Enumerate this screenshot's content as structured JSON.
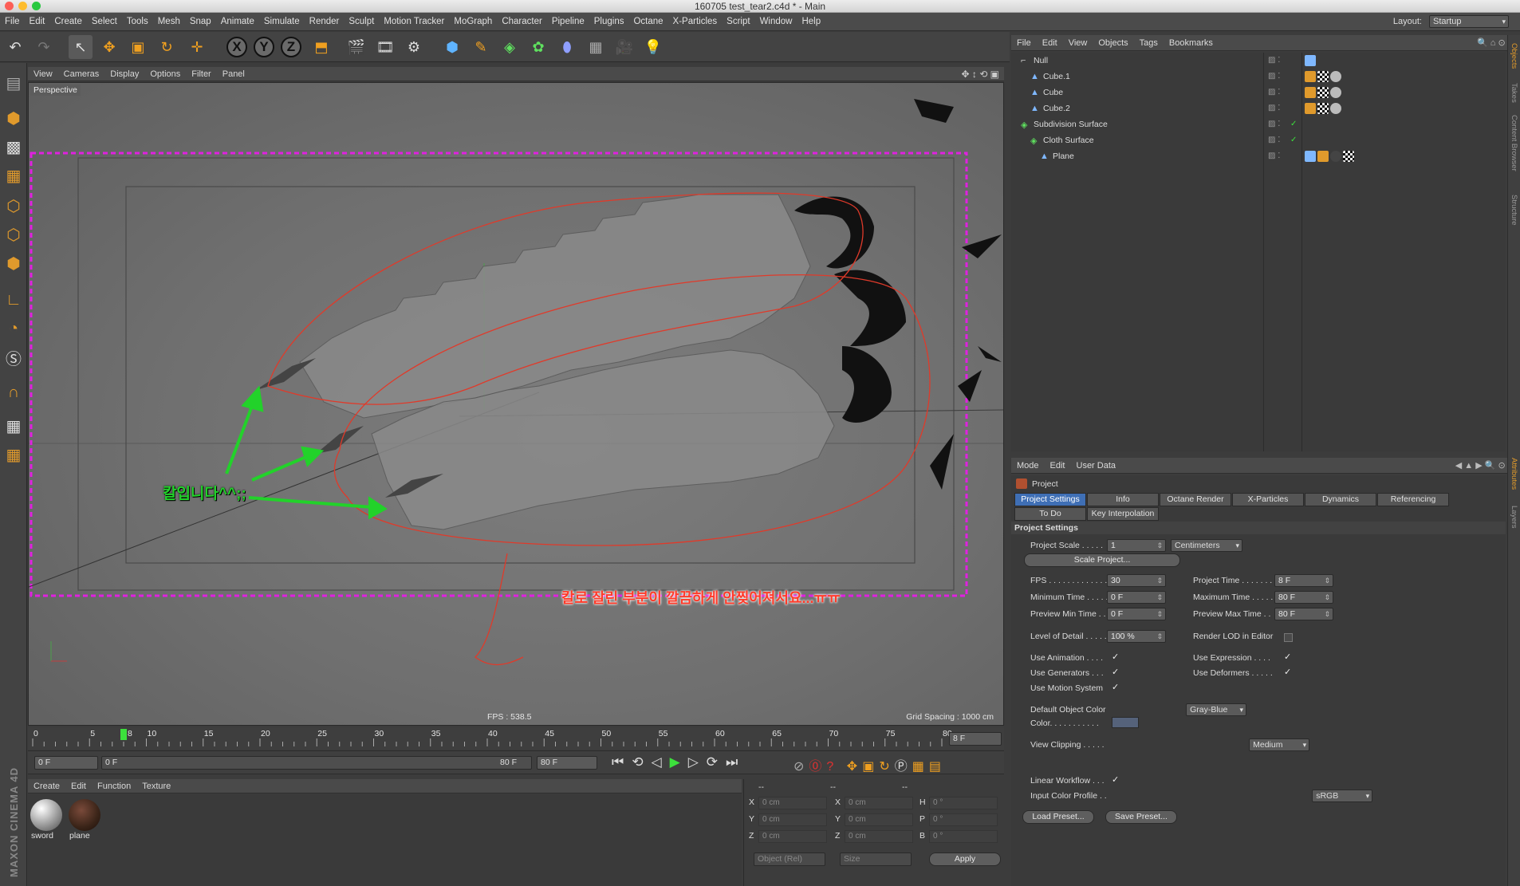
{
  "window": {
    "title": "160705 test_tear2.c4d * - Main"
  },
  "menubar": {
    "items": [
      "File",
      "Edit",
      "Create",
      "Select",
      "Tools",
      "Mesh",
      "Snap",
      "Animate",
      "Simulate",
      "Render",
      "Sculpt",
      "Motion Tracker",
      "MoGraph",
      "Character",
      "Pipeline",
      "Plugins",
      "Octane",
      "X-Particles",
      "Script",
      "Window",
      "Help"
    ],
    "layout_label": "Layout:",
    "layout_value": "Startup"
  },
  "toolbar": {
    "axis_x": "X",
    "axis_y": "Y",
    "axis_z": "Z"
  },
  "viewport": {
    "menu": [
      "View",
      "Cameras",
      "Display",
      "Options",
      "Filter",
      "Panel"
    ],
    "camera_label": "Perspective",
    "fps": "FPS : 538.5",
    "grid_spacing": "Grid Spacing : 1000 cm",
    "annotation_knife": "칼입니다^^;;",
    "annotation_problem": "칼로 잘린 부분이 깔끔하게 안찢어져서요...ㅠㅠ",
    "colors": {
      "annotation_green": "#22d22a",
      "annotation_red": "#e03a2a",
      "safe_frame": "#e020e0"
    }
  },
  "timeline": {
    "ticks": [
      "0",
      "5",
      "10",
      "15",
      "20",
      "25",
      "30",
      "35",
      "40",
      "45",
      "50",
      "55",
      "60",
      "65",
      "70",
      "75",
      "80"
    ],
    "current_frame_marker": "8",
    "end_field": "8 F"
  },
  "anim_bar": {
    "start_field": "0 F",
    "range_start": "0 F",
    "range_end": "80 F",
    "end_field": "80 F"
  },
  "materials": {
    "menu": [
      "Create",
      "Edit",
      "Function",
      "Texture"
    ],
    "items": [
      {
        "name": "sword"
      },
      {
        "name": "plane"
      }
    ]
  },
  "coordinates": {
    "header_left": "--",
    "header_mid": "--",
    "header_right": "--",
    "rows": [
      {
        "pos_label": "X",
        "pos": "0 cm",
        "size_label": "X",
        "size": "0 cm",
        "rot_label": "H",
        "rot": "0 °"
      },
      {
        "pos_label": "Y",
        "pos": "0 cm",
        "size_label": "Y",
        "size": "0 cm",
        "rot_label": "P",
        "rot": "0 °"
      },
      {
        "pos_label": "Z",
        "pos": "0 cm",
        "size_label": "Z",
        "size": "0 cm",
        "rot_label": "B",
        "rot": "0 °"
      }
    ],
    "mode_dropdown": "Object (Rel)",
    "size_dropdown": "Size",
    "apply": "Apply"
  },
  "objects": {
    "menu": [
      "File",
      "Edit",
      "View",
      "Objects",
      "Tags",
      "Bookmarks"
    ],
    "tree": [
      {
        "name": "Null",
        "depth": 0
      },
      {
        "name": "Cube.1",
        "depth": 1
      },
      {
        "name": "Cube",
        "depth": 1
      },
      {
        "name": "Cube.2",
        "depth": 1
      },
      {
        "name": "Subdivision Surface",
        "depth": 0
      },
      {
        "name": "Cloth Surface",
        "depth": 1
      },
      {
        "name": "Plane",
        "depth": 2
      }
    ]
  },
  "attributes": {
    "menu": [
      "Mode",
      "Edit",
      "User Data"
    ],
    "object_name": "Project",
    "tabs_row1": [
      "Project Settings",
      "Info",
      "Octane Render",
      "X-Particles",
      "Dynamics",
      "Referencing"
    ],
    "tabs_row2": [
      "To Do",
      "Key Interpolation"
    ],
    "section_title": "Project Settings",
    "project_scale_label": "Project Scale . . . . .",
    "project_scale_value": "1",
    "project_scale_unit": "Centimeters",
    "scale_project_button": "Scale Project...",
    "fps_label": "FPS . . . . . . . . . . . . .",
    "fps_value": "30",
    "project_time_label": "Project Time . . . . . . .",
    "project_time_value": "8 F",
    "min_time_label": "Minimum Time . . . . .",
    "min_time_value": "0 F",
    "max_time_label": "Maximum Time . . . . .",
    "max_time_value": "80 F",
    "prev_min_label": "Preview Min Time . .",
    "prev_min_value": "0 F",
    "prev_max_label": "Preview Max Time . .",
    "prev_max_value": "80 F",
    "lod_label": "Level of Detail . . . . .",
    "lod_value": "100 %",
    "render_lod_label": "Render LOD in Editor",
    "use_animation_label": "Use Animation . . . .",
    "use_expression_label": "Use Expression . . . .",
    "use_generators_label": "Use Generators . . .",
    "use_deformers_label": "Use Deformers . . . . .",
    "use_motion_label": "Use Motion System",
    "default_color_label": "Default Object Color",
    "default_color_value": "Gray-Blue",
    "color_label": "Color. . . . . . . . . . .",
    "view_clipping_label": "View Clipping . . . . .",
    "view_clipping_value": "Medium",
    "linear_workflow_label": "Linear Workflow . . .",
    "input_profile_label": "Input Color Profile . .",
    "input_profile_value": "sRGB",
    "load_preset": "Load Preset...",
    "save_preset": "Save Preset...",
    "check_mark": "✓"
  },
  "right_strip": [
    "Objects",
    "Takes",
    "Content Browser",
    "Structure",
    "Attributes",
    "Layers"
  ],
  "brand": "MAXON CINEMA 4D"
}
